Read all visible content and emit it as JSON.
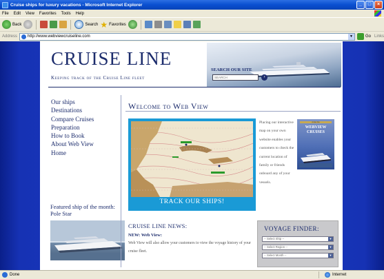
{
  "window": {
    "title": "Cruise ships for luxury vacations - Microsoft Internet Explorer",
    "minimize": "_",
    "maximize": "□",
    "close": "×"
  },
  "menu": [
    "File",
    "Edit",
    "View",
    "Favorites",
    "Tools",
    "Help"
  ],
  "toolbar": {
    "back": "Back",
    "search": "Search",
    "favorites": "Favorites"
  },
  "address": {
    "label": "Address",
    "url": "http://www.webviewcruiseline.com",
    "go": "Go",
    "links": "Links"
  },
  "site": {
    "logo": "CRUISE LINE",
    "tagline": "Keeping track of the Cruise Line fleet",
    "search_label": "SEARCH OUR SITE",
    "search_placeholder": "SEARCH"
  },
  "nav": [
    "Our ships",
    "Destinations",
    "Compare Cruises",
    "Preparation",
    "How to Book",
    "About Web View",
    "Home"
  ],
  "featured": {
    "title": "Featured ship of the month: Pole Star"
  },
  "main": {
    "heading": "Welcome to Web View",
    "map_button": "TRACK OUR SHIPS!",
    "promo_text": "Placing our interactive map on your own website enables your customers to check the current location of family or friends onboard any of your vessels.",
    "webview_badge_small": "cruise line",
    "webview_badge_line1": "WEBVIEW",
    "webview_badge_line2": "CRUISES"
  },
  "news": {
    "heading": "CRUISE LINE NEWS:",
    "subheading": "NEW: Web View:",
    "body": "Web View will also allow your customers to view the voyage history of your cruise fleet."
  },
  "voyage_finder": {
    "heading": "VOYAGE FINDER:",
    "selects": [
      "-- Select Ship --",
      "-- Select Region --",
      "-- Select Month --"
    ]
  },
  "status": {
    "left": "Done",
    "zone": "Internet"
  },
  "colors": {
    "brand": "#1c2c6c",
    "map_frame": "#1a9ad6",
    "background": "#1d3cc4"
  }
}
